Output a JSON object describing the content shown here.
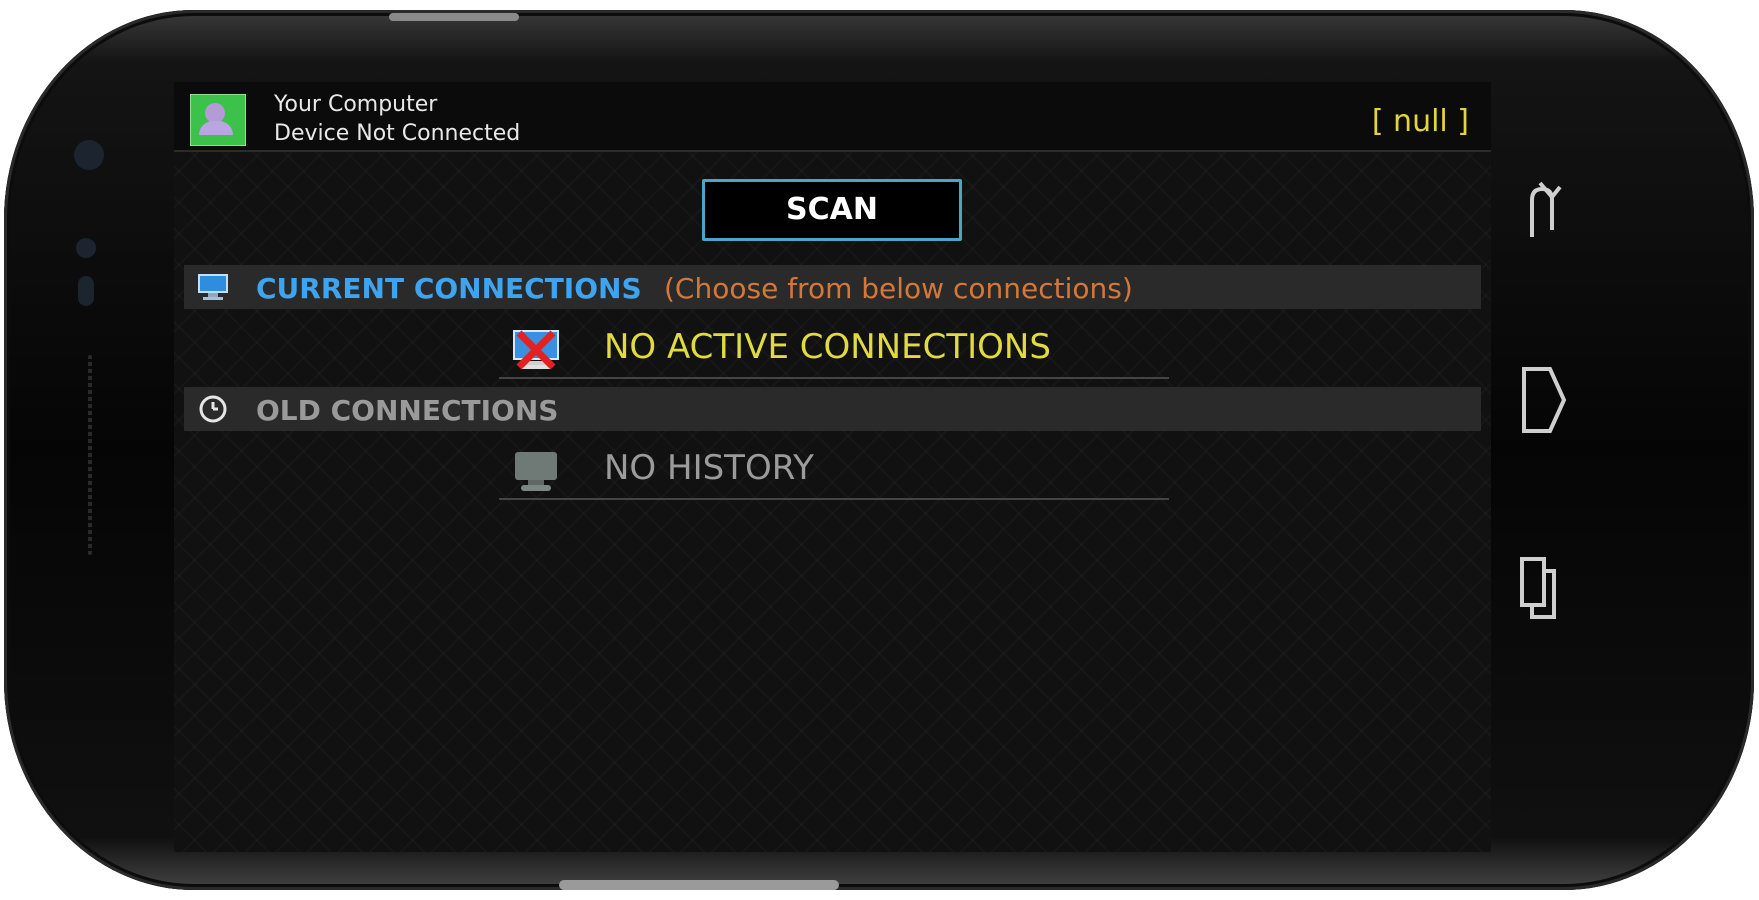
{
  "status": {
    "title": "Your Computer",
    "subtitle": "Device Not Connected",
    "right_label": "[ null ]"
  },
  "scan_button": {
    "label": "SCAN"
  },
  "current_connections": {
    "header": "CURRENT CONNECTIONS",
    "hint": "(Choose from below connections)",
    "empty_label": "NO ACTIVE CONNECTIONS"
  },
  "old_connections": {
    "header": "OLD CONNECTIONS",
    "empty_label": "NO HISTORY"
  },
  "icons": {
    "app": "person-icon",
    "current_header": "monitor-icon",
    "old_header": "clock-icon",
    "no_connection": "disconnected-monitor-icon",
    "no_history": "monitor-icon",
    "nav_back": "back-icon",
    "nav_home": "home-icon",
    "nav_recent": "recent-apps-icon"
  },
  "colors": {
    "accent_blue": "#3ea4f0",
    "hint_orange": "#d4783a",
    "status_yellow": "#e3d63a",
    "scan_border": "#4aa6c2"
  }
}
